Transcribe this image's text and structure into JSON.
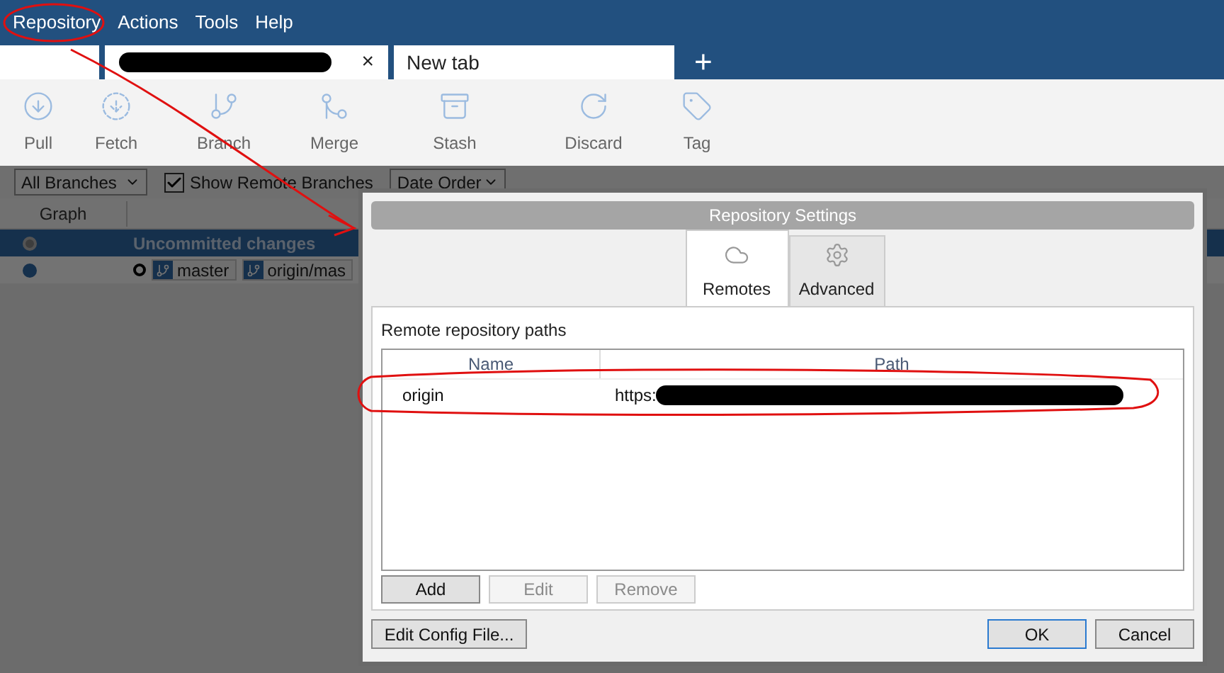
{
  "menu": [
    "Repository",
    "Actions",
    "Tools",
    "Help"
  ],
  "tabs": [
    {
      "kind": "blank"
    },
    {
      "kind": "redacted",
      "close": "×"
    },
    {
      "kind": "text",
      "label": "New tab"
    }
  ],
  "new_tab": "+",
  "toolbar": [
    {
      "label": "Pull"
    },
    {
      "label": "Fetch"
    },
    {
      "label": "Branch"
    },
    {
      "label": "Merge"
    },
    {
      "label": "Stash"
    },
    {
      "label": "Discard"
    },
    {
      "label": "Tag"
    }
  ],
  "filters": {
    "branches": "All Branches",
    "remote_checkbox": {
      "label": "Show Remote Branches",
      "checked": true
    },
    "order": "Date Order"
  },
  "graph": {
    "header": "Graph",
    "rows": [
      {
        "text": "Uncommitted changes",
        "selected": true
      },
      {
        "selected": false,
        "branches": [
          "master",
          "origin/mas"
        ]
      }
    ]
  },
  "dialog": {
    "title": "Repository Settings",
    "tabs": [
      {
        "label": "Remotes",
        "selected": true
      },
      {
        "label": "Advanced",
        "selected": false
      }
    ],
    "group_label": "Remote repository paths",
    "columns": [
      "Name",
      "Path"
    ],
    "rows": [
      {
        "name": "origin",
        "path": "https:"
      }
    ],
    "actions": [
      {
        "label": "Add",
        "disabled": false
      },
      {
        "label": "Edit",
        "disabled": true
      },
      {
        "label": "Remove",
        "disabled": true
      }
    ],
    "edit_config": "Edit Config File...",
    "ok": "OK",
    "cancel": "Cancel"
  }
}
